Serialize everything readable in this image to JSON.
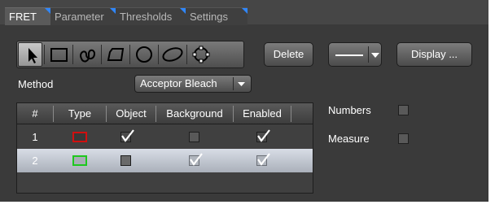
{
  "tabs": [
    {
      "label": "FRET",
      "active": true
    },
    {
      "label": "Parameter",
      "active": false
    },
    {
      "label": "Thresholds",
      "active": false
    },
    {
      "label": "Settings",
      "active": false
    }
  ],
  "toolbar": {
    "tools": [
      "arrow-icon",
      "rectangle-icon",
      "freehand-icon",
      "polygon-icon",
      "circle-icon",
      "ellipse-icon",
      "closed-spline-icon"
    ],
    "selected_tool": "arrow-icon",
    "delete_label": "Delete",
    "display_label": "Display ..."
  },
  "method": {
    "label": "Method",
    "value": "Acceptor Bleach"
  },
  "table": {
    "columns": [
      "#",
      "Type",
      "Object",
      "Background",
      "Enabled"
    ],
    "rows": [
      {
        "num": "1",
        "type_color": "#d01010",
        "object": true,
        "background": false,
        "enabled": true,
        "selected": false
      },
      {
        "num": "2",
        "type_color": "#1ec81e",
        "object": false,
        "background": true,
        "enabled": true,
        "selected": true
      }
    ]
  },
  "options": {
    "numbers_label": "Numbers",
    "numbers_checked": false,
    "measure_label": "Measure",
    "measure_checked": false
  },
  "colors": {
    "tab_accent": "#2f87ff",
    "panel_bg": "#3a3a3a"
  }
}
